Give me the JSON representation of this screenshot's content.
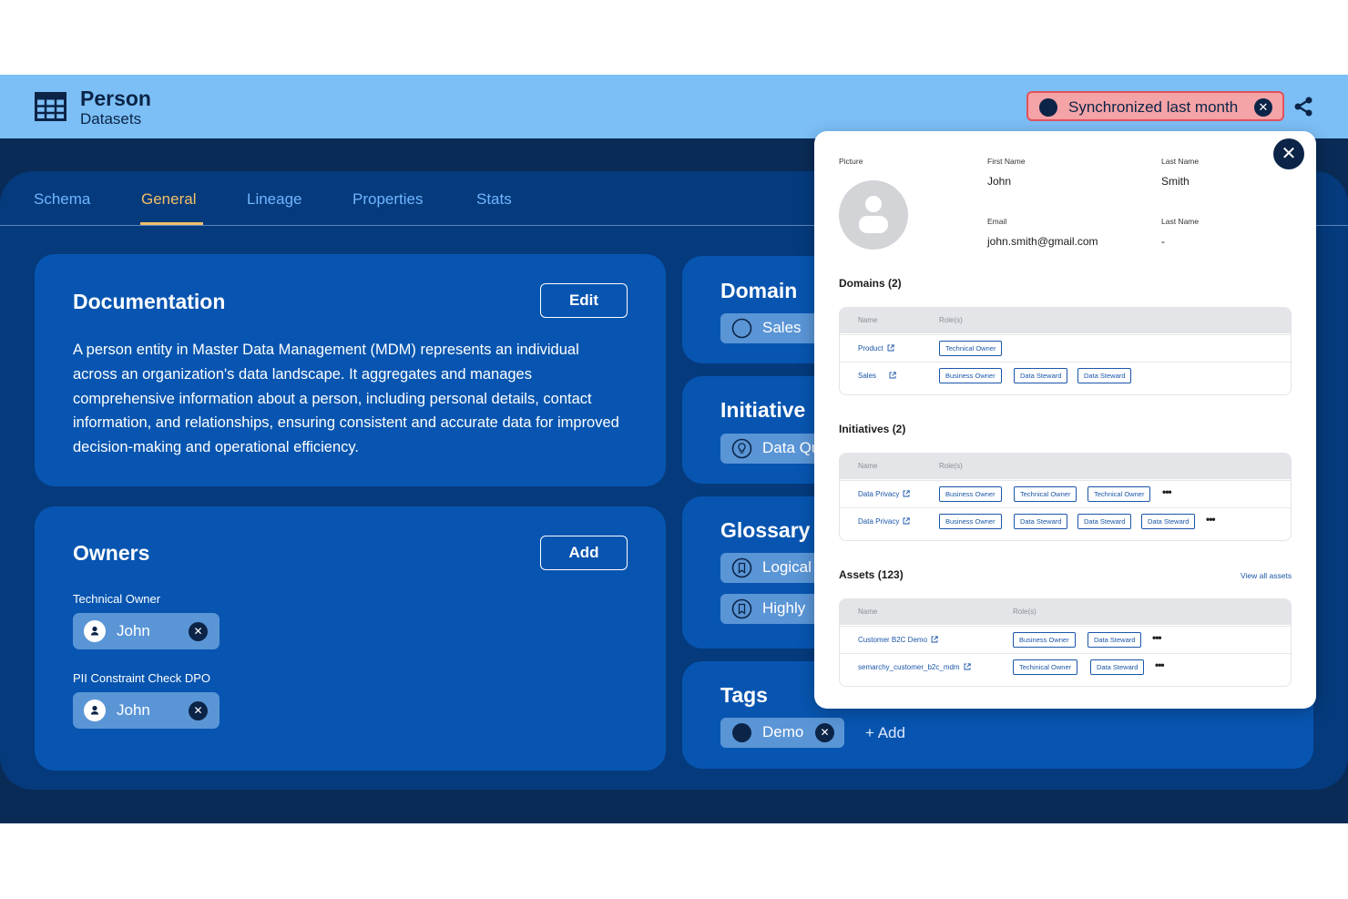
{
  "header": {
    "title": "Person",
    "subtitle": "Datasets",
    "sync_label": "Synchronized last month",
    "sync_close": "✕"
  },
  "tabs": [
    {
      "label": "Schema",
      "active": false
    },
    {
      "label": "General",
      "active": true
    },
    {
      "label": "Lineage",
      "active": false
    },
    {
      "label": "Properties",
      "active": false
    },
    {
      "label": "Stats",
      "active": false
    }
  ],
  "documentation": {
    "title": "Documentation",
    "edit_label": "Edit",
    "text": "A person entity in Master Data Management (MDM) represents an individual across an organization's data landscape. It aggregates and manages comprehensive information about a person, including personal details, contact information, and relationships, ensuring consistent and accurate data for improved decision-making and operational efficiency."
  },
  "owners": {
    "title": "Owners",
    "add_label": "Add",
    "groups": [
      {
        "label": "Technical Owner",
        "name": "John",
        "remove": "✕"
      },
      {
        "label": "PII Constraint Check DPO",
        "name": "John",
        "remove": "✕"
      }
    ]
  },
  "domain": {
    "title": "Domain",
    "items": [
      "Sales"
    ]
  },
  "initiative": {
    "title": "Initiative",
    "items": [
      "Data Quality"
    ]
  },
  "glossary": {
    "title": "Glossary",
    "items": [
      "Logical",
      "Highly"
    ]
  },
  "tags": {
    "title": "Tags",
    "items": [
      "Demo"
    ],
    "remove": "✕",
    "add_label": "+ Add"
  },
  "profile": {
    "close": "✕",
    "picture_label": "Picture",
    "first_name_label": "First Name",
    "first_name": "John",
    "last_name_label": "Last Name",
    "last_name": "Smith",
    "email_label": "Email",
    "email": "john.smith@gmail.com",
    "last_name2_label": "Last Name",
    "last_name2": "-",
    "domains": {
      "title": "Domains (2)",
      "col_name": "Name",
      "col_roles": "Role(s)",
      "rows": [
        {
          "name": "Product",
          "roles": [
            "Technical Owner"
          ]
        },
        {
          "name": "Sales",
          "roles": [
            "Business Owner",
            "Data Steward",
            "Data Steward"
          ]
        }
      ]
    },
    "initiatives": {
      "title": "Initiatives (2)",
      "col_name": "Name",
      "col_roles": "Role(s)",
      "rows": [
        {
          "name": "Data Privacy",
          "roles": [
            "Business Owner",
            "Technical Owner",
            "Technical Owner"
          ],
          "more": "•••"
        },
        {
          "name": "Data Privacy",
          "roles": [
            "Business Owner",
            "Data Steward",
            "Data Steward",
            "Data Steward"
          ],
          "more": "•••"
        }
      ]
    },
    "assets": {
      "title": "Assets (123)",
      "view_all": "View all assets",
      "col_name": "Name",
      "col_roles": "Role(s)",
      "rows": [
        {
          "name": "Customer B2C Demo",
          "roles": [
            "Business Owner",
            "Data Steward"
          ],
          "more": "•••"
        },
        {
          "name": "semarchy_customer_b2c_mdm",
          "roles": [
            "Techinical Owner",
            "Data Steward"
          ],
          "more": "•••"
        }
      ]
    }
  },
  "colors": {
    "header_bg": "#7cbff6",
    "page_bg": "#092b56",
    "panel_bg": "#053a7c",
    "card_bg": "#0755b0",
    "chip_bg": "#5a95d6",
    "active_tab": "#f2c067",
    "sync_badge_bg": "#f4a3a6",
    "link": "#1a56a8"
  },
  "icons": {
    "header": "table-grid-icon",
    "share": "share-icon",
    "domain": "circle-icon",
    "initiative": "lightbulb-icon",
    "glossary": "bookmark-icon",
    "external": "external-link-icon"
  }
}
